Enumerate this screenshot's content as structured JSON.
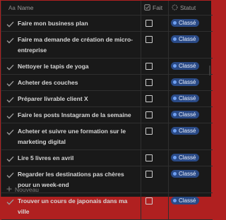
{
  "columns": {
    "name_label": "Name",
    "name_icon": "text-property-icon",
    "name_icon_glyph": "Aa",
    "fait_label": "Fait",
    "fait_icon": "checkbox-property-icon",
    "statut_label": "Statut",
    "statut_icon": "status-property-icon"
  },
  "status_color": "#2a4a86",
  "rows": [
    {
      "title": "Faire mon business plan",
      "done": false,
      "status": "Classé"
    },
    {
      "title": "Faire ma demande de création de micro-entreprise",
      "done": false,
      "status": "Classé"
    },
    {
      "title": "Nettoyer le tapis de yoga",
      "done": false,
      "status": "Classé"
    },
    {
      "title": "Acheter des couches",
      "done": false,
      "status": "Classé"
    },
    {
      "title": "Préparer livrable client X",
      "done": false,
      "status": "Classé"
    },
    {
      "title": "Faire les posts Instagram de la semaine",
      "done": false,
      "status": "Classé"
    },
    {
      "title": "Acheter et suivre une formation sur le marketing digital",
      "done": false,
      "status": "Classé"
    },
    {
      "title": "Lire 5 livres en avril",
      "done": false,
      "status": "Classé"
    },
    {
      "title": "Regarder les destinations pas chères pour un week-end",
      "done": false,
      "status": "Classé"
    },
    {
      "title": "Trouver un cours de japonais dans ma ville",
      "done": false,
      "status": "Classé"
    }
  ],
  "footer": {
    "new_label": "Nouveau"
  }
}
